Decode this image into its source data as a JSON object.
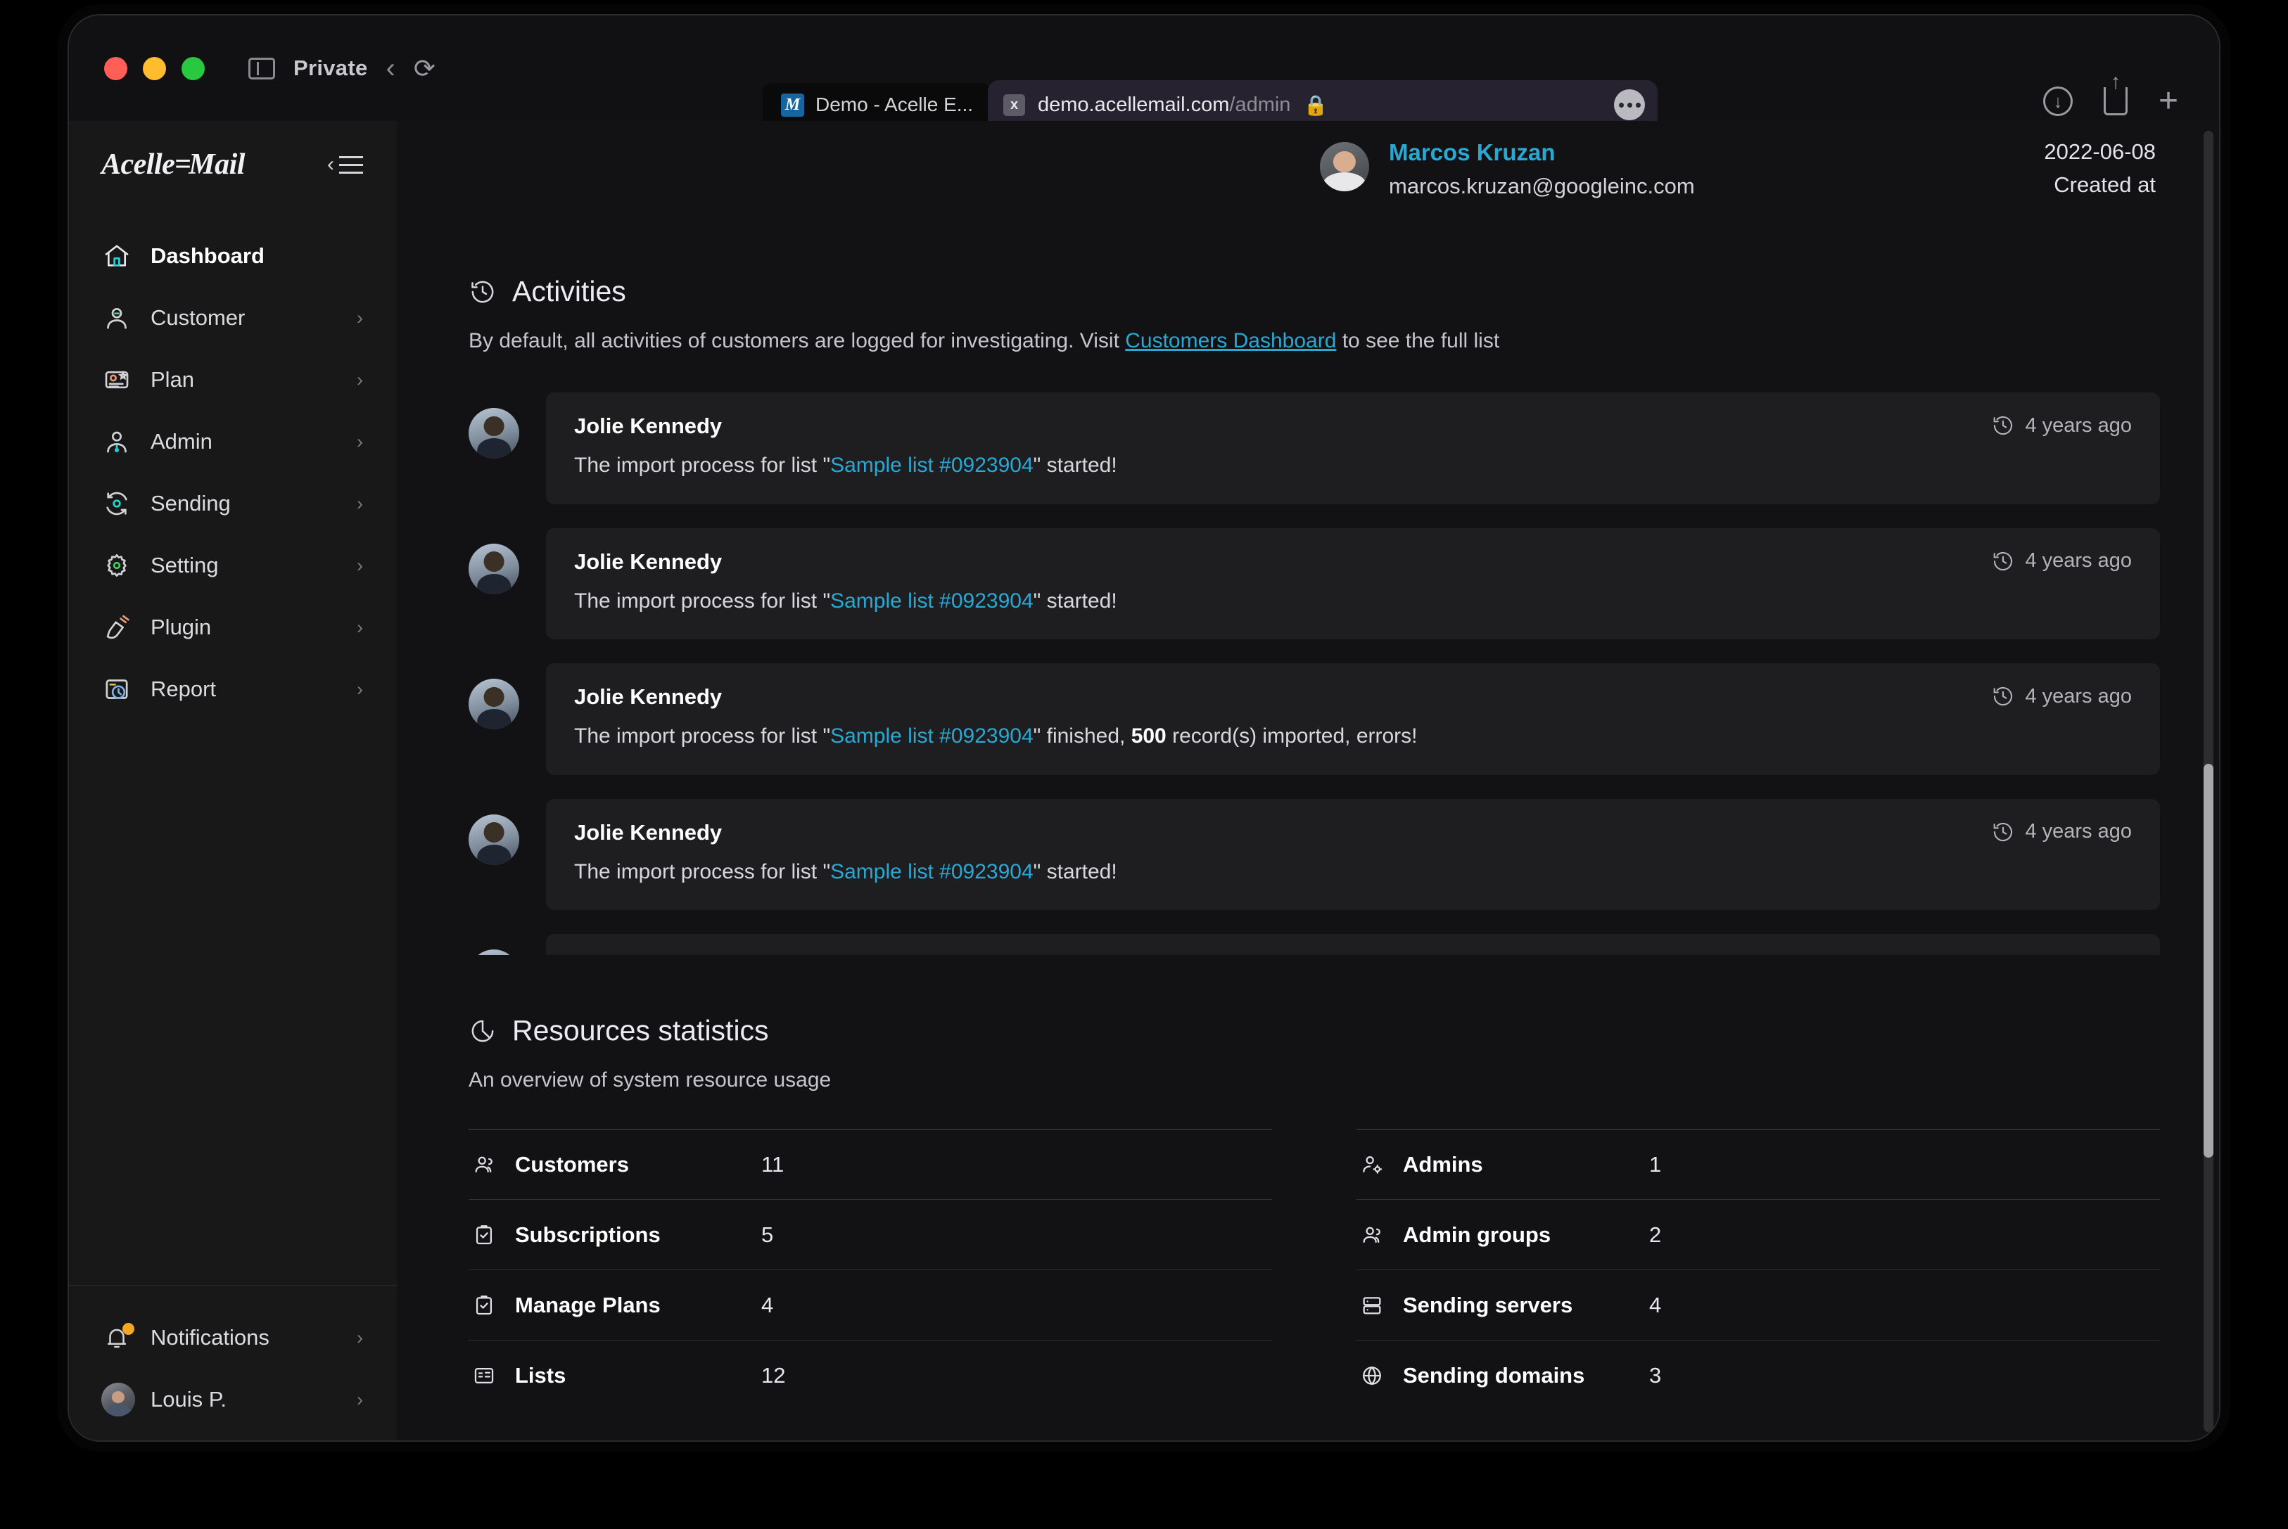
{
  "browser": {
    "private_label": "Private",
    "back_icon": "chevron-left-icon",
    "reload_icon": "reload-icon",
    "tab": {
      "title": "Demo - Acelle E...",
      "favicon_letter": "M"
    },
    "url": {
      "domain": "demo.acellemail.com",
      "path": "/admin",
      "shield_letter": "x",
      "lock": "🔒"
    },
    "toolbar_icons": [
      "download-icon",
      "share-icon",
      "new-tab-icon"
    ]
  },
  "sidebar": {
    "brand": {
      "part1": "Acelle",
      "dash": "=",
      "part2": "Mail"
    },
    "items": [
      {
        "label": "Dashboard",
        "icon": "home-icon",
        "active": true,
        "has_chevron": false
      },
      {
        "label": "Customer",
        "icon": "user-icon",
        "active": false,
        "has_chevron": true
      },
      {
        "label": "Plan",
        "icon": "plan-card-icon",
        "active": false,
        "has_chevron": true
      },
      {
        "label": "Admin",
        "icon": "admin-user-icon",
        "active": false,
        "has_chevron": true
      },
      {
        "label": "Sending",
        "icon": "sending-sync-icon",
        "active": false,
        "has_chevron": true
      },
      {
        "label": "Setting",
        "icon": "gear-icon",
        "active": false,
        "has_chevron": true
      },
      {
        "label": "Plugin",
        "icon": "plug-icon",
        "active": false,
        "has_chevron": true
      },
      {
        "label": "Report",
        "icon": "report-clock-icon",
        "active": false,
        "has_chevron": true
      }
    ],
    "bottom": [
      {
        "label": "Notifications",
        "icon": "bell-icon",
        "badge": true,
        "has_chevron": true
      },
      {
        "label": "Louis P.",
        "icon": "avatar",
        "badge": false,
        "has_chevron": true
      }
    ]
  },
  "customer_header": {
    "name": "Marcos Kruzan",
    "email": "marcos.kruzan@googleinc.com",
    "date": "2022-06-08",
    "created_label": "Created at"
  },
  "activities": {
    "title": "Activities",
    "icon": "history-icon",
    "description_before": "By default, all activities of customers are logged for investigating. Visit ",
    "link_text": "Customers Dashboard",
    "description_after": " to see the full list",
    "rows": [
      {
        "name": "Jolie Kennedy",
        "text_before": "The import process for list \"",
        "link": "Sample list #0923904",
        "text_after": "\" started!",
        "time": "4 years ago"
      },
      {
        "name": "Jolie Kennedy",
        "text_before": "The import process for list \"",
        "link": "Sample list #0923904",
        "text_after": "\" started!",
        "time": "4 years ago"
      },
      {
        "name": "Jolie Kennedy",
        "text_before": "The import process for list \"",
        "link": "Sample list #0923904",
        "text_after": "\" finished, ",
        "bold": "500",
        "text_tail": " record(s) imported, errors!",
        "time": "4 years ago"
      },
      {
        "name": "Jolie Kennedy",
        "text_before": "The import process for list \"",
        "link": "Sample list #0923904",
        "text_after": "\" started!",
        "time": "4 years ago"
      }
    ]
  },
  "resources": {
    "title": "Resources statistics",
    "icon": "pie-chart-icon",
    "subtitle": "An overview of system resource usage",
    "left_column": [
      {
        "label": "Customers",
        "value": "11",
        "icon": "users-icon"
      },
      {
        "label": "Subscriptions",
        "value": "5",
        "icon": "clipboard-check-icon"
      },
      {
        "label": "Manage Plans",
        "value": "4",
        "icon": "clipboard-check-icon"
      },
      {
        "label": "Lists",
        "value": "12",
        "icon": "list-icon"
      }
    ],
    "right_column": [
      {
        "label": "Admins",
        "value": "1",
        "icon": "user-gear-icon"
      },
      {
        "label": "Admin groups",
        "value": "2",
        "icon": "users-icon"
      },
      {
        "label": "Sending servers",
        "value": "4",
        "icon": "server-icon"
      },
      {
        "label": "Sending domains",
        "value": "3",
        "icon": "globe-icon"
      }
    ]
  },
  "colors": {
    "accent_link": "#29a8d4",
    "sidebar_bg": "#181819",
    "main_bg": "#121214",
    "card_bg": "#1e1e20",
    "badge": "#f5a623"
  }
}
